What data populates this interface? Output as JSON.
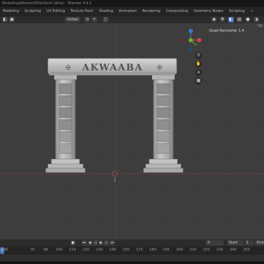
{
  "window": {
    "title": "Modelling\\Meshes\\Pillar\\Arch (dirty) - Blender 4.4.1"
  },
  "workspace_tabs": [
    {
      "label": "Modeling",
      "active": false
    },
    {
      "label": "Sculpting",
      "active": false
    },
    {
      "label": "UV Editing",
      "active": false
    },
    {
      "label": "Texture Paint",
      "active": false
    },
    {
      "label": "Shading",
      "active": false
    },
    {
      "label": "Animation",
      "active": false
    },
    {
      "label": "Rendering",
      "active": false
    },
    {
      "label": "Compositing",
      "active": false
    },
    {
      "label": "Geometry Nodes",
      "active": false
    },
    {
      "label": "Scripting",
      "active": false
    },
    {
      "label": "+",
      "active": false
    }
  ],
  "header": {
    "transform_orientation": "Global",
    "options_label": "Op"
  },
  "sidebar": {
    "panel_label": "Quad Remesher 1.4"
  },
  "model": {
    "inscription": "AKWAABA"
  },
  "timeline": {
    "current_frame": "1",
    "frame_field": "0",
    "start_label": "Start",
    "start_value": "1",
    "end_label": "End",
    "ruler_ticks": [
      "40",
      "70",
      "90",
      "100",
      "110",
      "120",
      "130",
      "140",
      "150",
      "170",
      "180",
      "195",
      "200",
      "210",
      "220",
      "230",
      "240",
      "250"
    ]
  },
  "colors": {
    "viewport_bg": "#3d3d3d",
    "axis_x": "#d8434e",
    "axis_y": "#7aab29",
    "axis_z": "#3b78d9",
    "accent": "#4772b3"
  },
  "icons": {
    "zoom": "magnifier-icon",
    "pan": "hand-icon",
    "camera": "camera-icon",
    "grid": "grid-icon"
  }
}
